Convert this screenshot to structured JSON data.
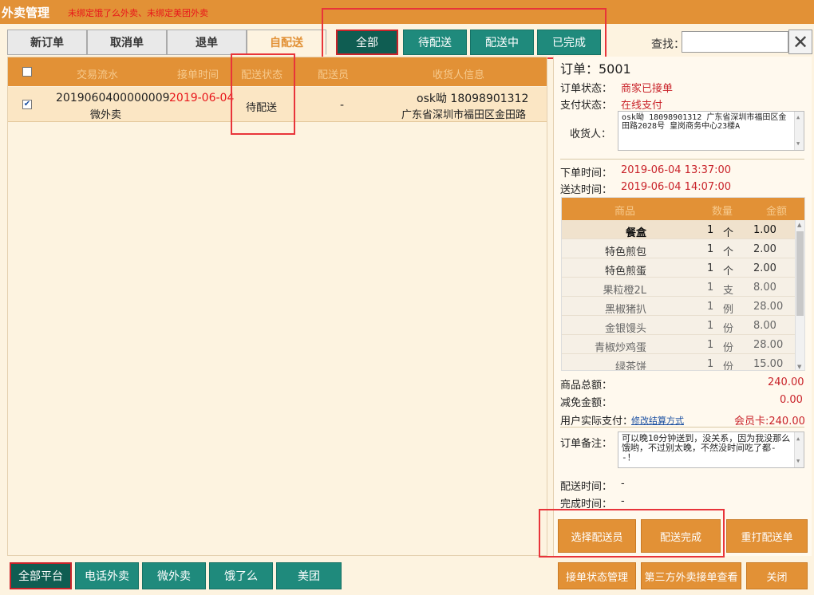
{
  "app": {
    "title": "外卖管理",
    "warning": "未绑定饿了么外卖、未绑定美团外卖"
  },
  "order_tabs": [
    {
      "label": "新订单",
      "active": false
    },
    {
      "label": "取消单",
      "active": false
    },
    {
      "label": "退单",
      "active": false
    },
    {
      "label": "自配送",
      "active": true
    }
  ],
  "status_filters": [
    {
      "label": "全部",
      "selected": true
    },
    {
      "label": "待配送",
      "selected": false
    },
    {
      "label": "配送中",
      "selected": false
    },
    {
      "label": "已完成",
      "selected": false
    }
  ],
  "search": {
    "label": "查找：",
    "value": ""
  },
  "table": {
    "columns": [
      "交易流水",
      "接单时间",
      "配送状态",
      "配送员",
      "收货人信息"
    ],
    "rows": [
      {
        "checked": true,
        "serial": "2019060400000009",
        "source": "微外卖",
        "time": "2019-06-04",
        "status": "待配送",
        "courier": "-",
        "receiver": "osk呦 18098901312",
        "address": "广东省深圳市福田区金田路"
      }
    ]
  },
  "detail": {
    "order_no": "订单：5001",
    "order_status_label": "订单状态：",
    "order_status": "商家已接单",
    "pay_status_label": "支付状态：",
    "pay_status": "在线支付",
    "receiver_label": "收货人：",
    "receiver_text": "osk呦 18098901312 广东省深圳市福田区金田路2028号 皇岗商务中心23楼A",
    "order_time_label": "下单时间：",
    "order_time": "2019-06-04 13:37:00",
    "arrive_time_label": "送达时间：",
    "arrive_time": "2019-06-04 14:07:00",
    "item_columns": [
      "商品",
      "数量",
      "金额"
    ],
    "items": [
      {
        "name": "餐盒",
        "qty": "1",
        "unit": "个",
        "amount": "1.00"
      },
      {
        "name": "特色煎包",
        "qty": "1",
        "unit": "个",
        "amount": "2.00"
      },
      {
        "name": "特色煎蛋",
        "qty": "1",
        "unit": "个",
        "amount": "2.00"
      },
      {
        "name": "果粒橙2L",
        "qty": "1",
        "unit": "支",
        "amount": "8.00"
      },
      {
        "name": "黑椒猪扒",
        "qty": "1",
        "unit": "例",
        "amount": "28.00"
      },
      {
        "name": "金银馒头",
        "qty": "1",
        "unit": "份",
        "amount": "8.00"
      },
      {
        "name": "青椒炒鸡蛋",
        "qty": "1",
        "unit": "份",
        "amount": "28.00"
      },
      {
        "name": "绿茶饼",
        "qty": "1",
        "unit": "份",
        "amount": "15.00"
      }
    ],
    "total_label": "商品总额：",
    "total": "240.00",
    "discount_label": "减免金额：",
    "discount": "0.00",
    "actual_label": "用户实际支付：",
    "modify_link": "修改结算方式",
    "actual": "会员卡:240.00",
    "note_label": "订单备注：",
    "note": "可以晚10分钟送到，没关系，因为我没那么饿哟，不过别太晚，不然没时间吃了都- -！",
    "deliver_time_label": "配送时间：",
    "deliver_time": "-",
    "finish_time_label": "完成时间：",
    "finish_time": "-"
  },
  "actions": {
    "choose_courier": "选择配送员",
    "delivered": "配送完成",
    "reprint": "重打配送单"
  },
  "platforms": [
    {
      "label": "全部平台",
      "selected": true
    },
    {
      "label": "电话外卖",
      "selected": false
    },
    {
      "label": "微外卖",
      "selected": false
    },
    {
      "label": "饿了么",
      "selected": false
    },
    {
      "label": "美团",
      "selected": false
    }
  ],
  "bottom": {
    "status_manage": "接单状态管理",
    "third_party": "第三方外卖接单查看",
    "close": "关闭"
  },
  "colors": {
    "accent": "#e29136",
    "teal": "#1f8a7c",
    "red": "#c9232a",
    "panel": "#fdf3e0"
  }
}
